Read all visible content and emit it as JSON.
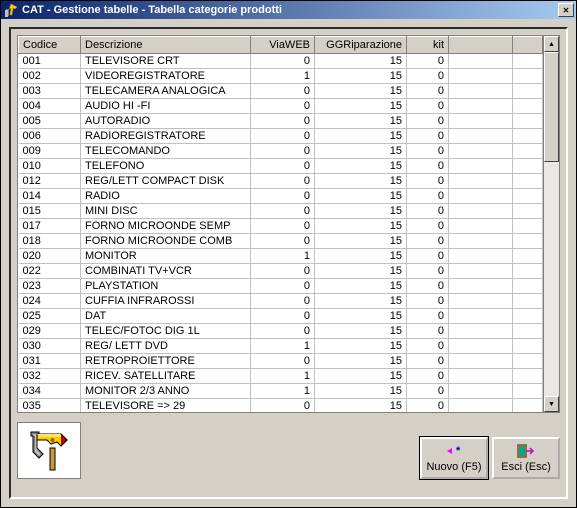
{
  "window": {
    "title": "CAT - Gestione tabelle - Tabella categorie prodotti"
  },
  "grid": {
    "columns": {
      "codice": "Codice",
      "descrizione": "Descrizione",
      "viaweb": "ViaWEB",
      "ggrip": "GGRiparazione",
      "kit": "kit"
    },
    "rows": [
      {
        "codice": "001",
        "descrizione": "TELEVISORE CRT",
        "viaweb": "0",
        "ggrip": "15",
        "kit": "0"
      },
      {
        "codice": "002",
        "descrizione": "VIDEOREGISTRATORE",
        "viaweb": "1",
        "ggrip": "15",
        "kit": "0"
      },
      {
        "codice": "003",
        "descrizione": "TELECAMERA ANALOGICA",
        "viaweb": "0",
        "ggrip": "15",
        "kit": "0"
      },
      {
        "codice": "004",
        "descrizione": "AUDIO HI -FI",
        "viaweb": "0",
        "ggrip": "15",
        "kit": "0"
      },
      {
        "codice": "005",
        "descrizione": "AUTORADIO",
        "viaweb": "0",
        "ggrip": "15",
        "kit": "0"
      },
      {
        "codice": "006",
        "descrizione": "RADIOREGISTRATORE",
        "viaweb": "0",
        "ggrip": "15",
        "kit": "0"
      },
      {
        "codice": "009",
        "descrizione": "TELECOMANDO",
        "viaweb": "0",
        "ggrip": "15",
        "kit": "0"
      },
      {
        "codice": "010",
        "descrizione": "TELEFONO",
        "viaweb": "0",
        "ggrip": "15",
        "kit": "0"
      },
      {
        "codice": "012",
        "descrizione": "REG/LETT COMPACT DISK",
        "viaweb": "0",
        "ggrip": "15",
        "kit": "0"
      },
      {
        "codice": "014",
        "descrizione": "RADIO",
        "viaweb": "0",
        "ggrip": "15",
        "kit": "0"
      },
      {
        "codice": "015",
        "descrizione": "MINI DISC",
        "viaweb": "0",
        "ggrip": "15",
        "kit": "0"
      },
      {
        "codice": "017",
        "descrizione": "FORNO MICROONDE SEMP",
        "viaweb": "0",
        "ggrip": "15",
        "kit": "0"
      },
      {
        "codice": "018",
        "descrizione": "FORNO MICROONDE COMB",
        "viaweb": "0",
        "ggrip": "15",
        "kit": "0"
      },
      {
        "codice": "020",
        "descrizione": "MONITOR",
        "viaweb": "1",
        "ggrip": "15",
        "kit": "0"
      },
      {
        "codice": "022",
        "descrizione": "COMBINATI TV+VCR",
        "viaweb": "0",
        "ggrip": "15",
        "kit": "0"
      },
      {
        "codice": "023",
        "descrizione": "PLAYSTATION",
        "viaweb": "0",
        "ggrip": "15",
        "kit": "0"
      },
      {
        "codice": "024",
        "descrizione": "CUFFIA INFRAROSSI",
        "viaweb": "0",
        "ggrip": "15",
        "kit": "0"
      },
      {
        "codice": "025",
        "descrizione": "DAT",
        "viaweb": "0",
        "ggrip": "15",
        "kit": "0"
      },
      {
        "codice": "029",
        "descrizione": "TELEC/FOTOC DIG 1L",
        "viaweb": "0",
        "ggrip": "15",
        "kit": "0"
      },
      {
        "codice": "030",
        "descrizione": "REG/ LETT DVD",
        "viaweb": "1",
        "ggrip": "15",
        "kit": "0"
      },
      {
        "codice": "031",
        "descrizione": "RETROPROIETTORE",
        "viaweb": "0",
        "ggrip": "15",
        "kit": "0"
      },
      {
        "codice": "032",
        "descrizione": "RICEV. SATELLITARE",
        "viaweb": "1",
        "ggrip": "15",
        "kit": "0"
      },
      {
        "codice": "034",
        "descrizione": "MONITOR 2/3 ANNO",
        "viaweb": "1",
        "ggrip": "15",
        "kit": "0"
      },
      {
        "codice": "035",
        "descrizione": "TELEVISORE => 29",
        "viaweb": "0",
        "ggrip": "15",
        "kit": "0"
      }
    ]
  },
  "buttons": {
    "nuovo": "Nuovo (F5)",
    "esci": "Esci (Esc)"
  }
}
